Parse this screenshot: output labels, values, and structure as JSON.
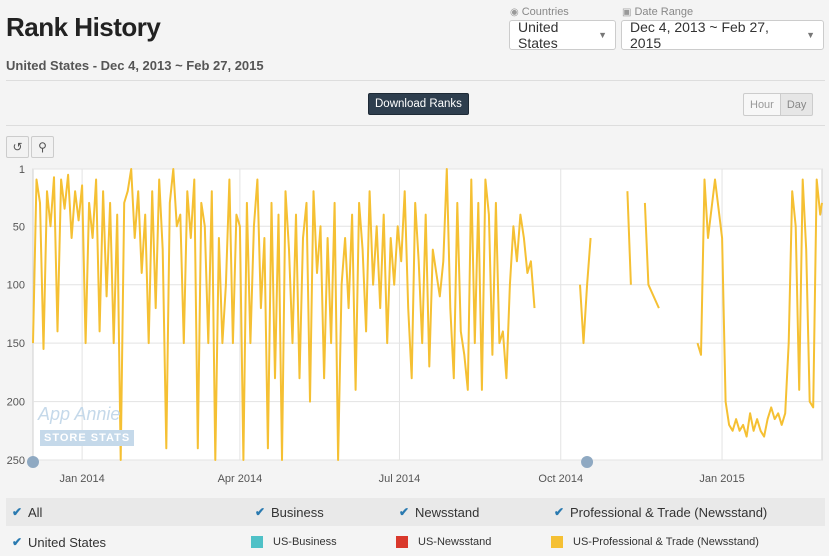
{
  "header": {
    "title": "Rank History",
    "country": "United States",
    "range_sep": " - ",
    "date_range": "Dec 4, 2013 ~ Feb 27, 2015"
  },
  "filters": {
    "countries_label": "Countries",
    "countries_value": "United States",
    "date_range_label": "Date Range",
    "date_range_value": "Dec 4, 2013 ~ Feb 27, 2015"
  },
  "toolbar": {
    "download_label": "Download Ranks",
    "hour_label": "Hour",
    "day_label": "Day"
  },
  "icons": {
    "reset": "reset-zoom-icon",
    "zoom": "zoom-icon",
    "globe": "globe-icon",
    "calendar": "calendar-icon"
  },
  "chart_data": {
    "type": "line",
    "y_reversed": true,
    "ylim": [
      1,
      250
    ],
    "yticks": [
      "1",
      "50",
      "100",
      "150",
      "200",
      "250"
    ],
    "ytick_values": [
      1,
      50,
      100,
      150,
      200,
      250
    ],
    "xticks": [
      "Jan 2014",
      "Apr 2014",
      "Jul 2014",
      "Oct 2014",
      "Jan 2015"
    ],
    "xtick_dates": [
      "2014-01-01",
      "2014-04-01",
      "2014-07-01",
      "2014-10-01",
      "2015-01-01"
    ],
    "x_range": [
      "2013-12-04",
      "2015-02-27"
    ],
    "series": [
      {
        "name": "US-Professional & Trade (Newsstand)",
        "color": "#f5c033",
        "points": [
          [
            "2013-12-04",
            150
          ],
          [
            "2013-12-06",
            10
          ],
          [
            "2013-12-08",
            30
          ],
          [
            "2013-12-10",
            155
          ],
          [
            "2013-12-12",
            20
          ],
          [
            "2013-12-14",
            50
          ],
          [
            "2013-12-16",
            8
          ],
          [
            "2013-12-18",
            140
          ],
          [
            "2013-12-20",
            10
          ],
          [
            "2013-12-22",
            35
          ],
          [
            "2013-12-24",
            6
          ],
          [
            "2013-12-26",
            60
          ],
          [
            "2013-12-28",
            20
          ],
          [
            "2013-12-30",
            45
          ],
          [
            "2014-01-01",
            15
          ],
          [
            "2014-01-03",
            150
          ],
          [
            "2014-01-05",
            30
          ],
          [
            "2014-01-07",
            60
          ],
          [
            "2014-01-09",
            10
          ],
          [
            "2014-01-11",
            140
          ],
          [
            "2014-01-13",
            20
          ],
          [
            "2014-01-15",
            110
          ],
          [
            "2014-01-17",
            30
          ],
          [
            "2014-01-19",
            150
          ],
          [
            "2014-01-21",
            40
          ],
          [
            "2014-01-23",
            250
          ],
          [
            "2014-01-25",
            30
          ],
          [
            "2014-01-27",
            20
          ],
          [
            "2014-01-29",
            1
          ],
          [
            "2014-01-31",
            60
          ],
          [
            "2014-02-02",
            20
          ],
          [
            "2014-02-04",
            90
          ],
          [
            "2014-02-06",
            40
          ],
          [
            "2014-02-08",
            150
          ],
          [
            "2014-02-10",
            20
          ],
          [
            "2014-02-12",
            120
          ],
          [
            "2014-02-14",
            10
          ],
          [
            "2014-02-16",
            70
          ],
          [
            "2014-02-18",
            240
          ],
          [
            "2014-02-20",
            30
          ],
          [
            "2014-02-22",
            1
          ],
          [
            "2014-02-24",
            50
          ],
          [
            "2014-02-26",
            40
          ],
          [
            "2014-02-28",
            150
          ],
          [
            "2014-03-02",
            20
          ],
          [
            "2014-03-04",
            60
          ],
          [
            "2014-03-06",
            10
          ],
          [
            "2014-03-08",
            240
          ],
          [
            "2014-03-10",
            30
          ],
          [
            "2014-03-12",
            50
          ],
          [
            "2014-03-14",
            150
          ],
          [
            "2014-03-16",
            20
          ],
          [
            "2014-03-18",
            250
          ],
          [
            "2014-03-20",
            60
          ],
          [
            "2014-03-22",
            150
          ],
          [
            "2014-03-24",
            100
          ],
          [
            "2014-03-26",
            10
          ],
          [
            "2014-03-28",
            150
          ],
          [
            "2014-03-30",
            40
          ],
          [
            "2014-04-01",
            50
          ],
          [
            "2014-04-03",
            250
          ],
          [
            "2014-04-05",
            30
          ],
          [
            "2014-04-07",
            150
          ],
          [
            "2014-04-09",
            50
          ],
          [
            "2014-04-11",
            10
          ],
          [
            "2014-04-13",
            120
          ],
          [
            "2014-04-15",
            60
          ],
          [
            "2014-04-17",
            240
          ],
          [
            "2014-04-19",
            30
          ],
          [
            "2014-04-21",
            180
          ],
          [
            "2014-04-23",
            40
          ],
          [
            "2014-04-25",
            250
          ],
          [
            "2014-04-27",
            20
          ],
          [
            "2014-04-29",
            70
          ],
          [
            "2014-05-01",
            150
          ],
          [
            "2014-05-03",
            40
          ],
          [
            "2014-05-05",
            180
          ],
          [
            "2014-05-07",
            60
          ],
          [
            "2014-05-09",
            30
          ],
          [
            "2014-05-11",
            200
          ],
          [
            "2014-05-13",
            20
          ],
          [
            "2014-05-15",
            90
          ],
          [
            "2014-05-17",
            50
          ],
          [
            "2014-05-19",
            180
          ],
          [
            "2014-05-21",
            60
          ],
          [
            "2014-05-23",
            150
          ],
          [
            "2014-05-25",
            30
          ],
          [
            "2014-05-27",
            250
          ],
          [
            "2014-05-29",
            100
          ],
          [
            "2014-05-31",
            60
          ],
          [
            "2014-06-02",
            120
          ],
          [
            "2014-06-04",
            40
          ],
          [
            "2014-06-06",
            190
          ],
          [
            "2014-06-08",
            30
          ],
          [
            "2014-06-10",
            70
          ],
          [
            "2014-06-12",
            140
          ],
          [
            "2014-06-14",
            20
          ],
          [
            "2014-06-16",
            100
          ],
          [
            "2014-06-18",
            50
          ],
          [
            "2014-06-20",
            120
          ],
          [
            "2014-06-22",
            40
          ],
          [
            "2014-06-24",
            150
          ],
          [
            "2014-06-26",
            60
          ],
          [
            "2014-06-28",
            100
          ],
          [
            "2014-06-30",
            50
          ],
          [
            "2014-07-02",
            80
          ],
          [
            "2014-07-04",
            20
          ],
          [
            "2014-07-06",
            120
          ],
          [
            "2014-07-08",
            180
          ],
          [
            "2014-07-10",
            30
          ],
          [
            "2014-07-12",
            80
          ],
          [
            "2014-07-14",
            150
          ],
          [
            "2014-07-16",
            40
          ],
          [
            "2014-07-18",
            170
          ],
          [
            "2014-07-20",
            70
          ],
          [
            "2014-07-22",
            90
          ],
          [
            "2014-07-24",
            110
          ],
          [
            "2014-07-26",
            80
          ],
          [
            "2014-07-28",
            1
          ],
          [
            "2014-07-30",
            120
          ],
          [
            "2014-08-01",
            180
          ],
          [
            "2014-08-03",
            30
          ],
          [
            "2014-08-05",
            140
          ],
          [
            "2014-08-07",
            160
          ],
          [
            "2014-08-09",
            190
          ],
          [
            "2014-08-11",
            10
          ],
          [
            "2014-08-13",
            150
          ],
          [
            "2014-08-15",
            30
          ],
          [
            "2014-08-17",
            190
          ],
          [
            "2014-08-19",
            10
          ],
          [
            "2014-08-21",
            40
          ],
          [
            "2014-08-23",
            160
          ],
          [
            "2014-08-25",
            30
          ],
          [
            "2014-08-27",
            150
          ],
          [
            "2014-08-29",
            140
          ],
          [
            "2014-08-31",
            180
          ],
          [
            "2014-09-02",
            100
          ],
          [
            "2014-09-04",
            50
          ],
          [
            "2014-09-06",
            80
          ],
          [
            "2014-09-08",
            40
          ],
          [
            "2014-09-10",
            60
          ],
          [
            "2014-09-12",
            90
          ],
          [
            "2014-09-14",
            80
          ],
          [
            "2014-09-16",
            120
          ],
          [
            "2014-10-12",
            100
          ],
          [
            "2014-10-14",
            150
          ],
          [
            "2014-10-16",
            100
          ],
          [
            "2014-10-18",
            60
          ],
          [
            "2014-11-08",
            20
          ],
          [
            "2014-11-10",
            100
          ],
          [
            "2014-11-18",
            30
          ],
          [
            "2014-11-20",
            100
          ],
          [
            "2014-11-26",
            120
          ],
          [
            "2014-12-18",
            150
          ],
          [
            "2014-12-20",
            160
          ],
          [
            "2014-12-22",
            10
          ],
          [
            "2014-12-24",
            60
          ],
          [
            "2014-12-28",
            10
          ],
          [
            "2015-01-01",
            60
          ],
          [
            "2015-01-03",
            200
          ],
          [
            "2015-01-05",
            220
          ],
          [
            "2015-01-07",
            225
          ],
          [
            "2015-01-09",
            215
          ],
          [
            "2015-01-11",
            225
          ],
          [
            "2015-01-13",
            220
          ],
          [
            "2015-01-15",
            230
          ],
          [
            "2015-01-17",
            210
          ],
          [
            "2015-01-19",
            225
          ],
          [
            "2015-01-21",
            215
          ],
          [
            "2015-01-23",
            225
          ],
          [
            "2015-01-25",
            230
          ],
          [
            "2015-01-27",
            215
          ],
          [
            "2015-01-29",
            205
          ],
          [
            "2015-01-31",
            215
          ],
          [
            "2015-02-02",
            210
          ],
          [
            "2015-02-04",
            220
          ],
          [
            "2015-02-06",
            210
          ],
          [
            "2015-02-08",
            150
          ],
          [
            "2015-02-10",
            20
          ],
          [
            "2015-02-12",
            50
          ],
          [
            "2015-02-14",
            190
          ],
          [
            "2015-02-16",
            10
          ],
          [
            "2015-02-18",
            70
          ],
          [
            "2015-02-20",
            200
          ],
          [
            "2015-02-22",
            205
          ],
          [
            "2015-02-24",
            10
          ],
          [
            "2015-02-26",
            40
          ],
          [
            "2015-02-27",
            30
          ]
        ]
      }
    ]
  },
  "watermark": {
    "line1": "App Annie",
    "line2": "STORE STATS"
  },
  "legend": {
    "all_label": "All",
    "business_label": "Business",
    "newsstand_label": "Newsstand",
    "pro_trade_label": "Professional & Trade (Newsstand)",
    "country_label": "United States",
    "series_business": "US-Business",
    "series_newsstand": "US-Newsstand",
    "series_pro_trade": "US-Professional & Trade (Newsstand)",
    "color_business": "#4fc1c7",
    "color_newsstand": "#d9382b",
    "color_pro_trade": "#f5c033"
  }
}
